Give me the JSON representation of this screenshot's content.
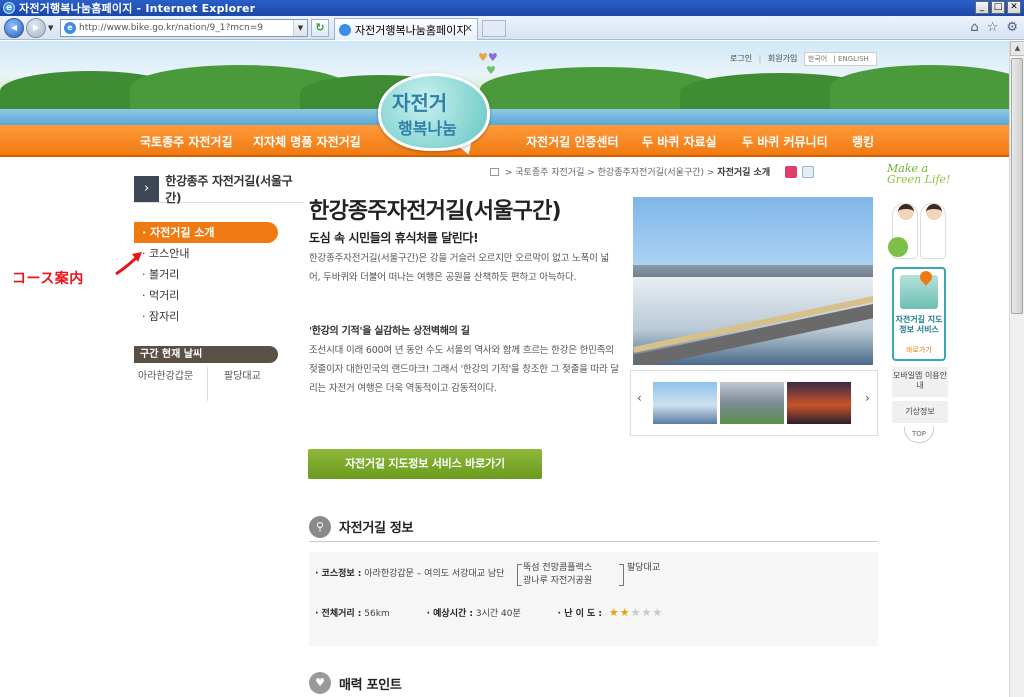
{
  "window": {
    "title": "자전거행복나눔홈페이지 - Internet Explorer",
    "minimize": "_",
    "maximize": "□",
    "close": "✕"
  },
  "browser": {
    "address": "http://www.bike.go.kr/nation/9_1?mcn=9",
    "tab_label": "자전거행복나눔홈페이지",
    "tab_close": "✕"
  },
  "header": {
    "logo_line1": "자전거",
    "logo_line2": "행복나눔",
    "top_links": [
      "로그인",
      "회원가입"
    ],
    "lang": [
      "한국어",
      "ENGLISH"
    ],
    "gnb": [
      "국토종주 자전거길",
      "지자체 명품 자전거길",
      "자전거길 인증센터",
      "두 바퀴 자료실",
      "두 바퀴 커뮤니티",
      "랭킹"
    ]
  },
  "lnb": {
    "title": "한강종주 자전거길(서울구간)",
    "items": [
      "· 자전거길 소개",
      "· 코스안내",
      "· 볼거리",
      "· 먹거리",
      "· 잠자리"
    ],
    "weather_title": "구간 현재 날씨",
    "weather_points": [
      "아라한강갑문",
      "팔당대교"
    ]
  },
  "annotation": {
    "text": "コース案内"
  },
  "breadcrumb": {
    "items": [
      "국토종주 자전거길",
      "한강종주자전거길(서울구간)"
    ],
    "current": "자전거길 소개"
  },
  "content": {
    "title": "한강종주자전거길(서울구간)",
    "subtitle": "도심 속 시민들의 휴식처를 달린다!",
    "para1": "한강종주자전거길(서울구간)은 강을 거슬러 오르지만 오르막이 없고 노폭이 넓어, 두바퀴와 더불어 떠나는 여행은 공원을 산책하듯 편하고 아늑하다.",
    "heading2": "'한강의 기적'을 실감하는 상전벽해의 길",
    "para2": "조선시대 이래 600여 년 동안 수도 서울의 역사와 함께 흐르는 한강은 한민족의 젖줄이자 대한민국의 랜드마크! 그래서 '한강의 기적'을 창조한 그 젖줄을 따라 달리는 자전거 여행은 더욱 역동적이고 감동적이다.",
    "map_button": "자전거길 지도정보 서비스 바로가기",
    "slider_prev": "‹",
    "slider_next": "›"
  },
  "info": {
    "section_title": "자전거길 정보",
    "course_label": "· 코스정보 :",
    "course_start": "아라한강갑문 – 여의도 서강대교 남단",
    "branch_top": "뚝섬 전망콤플렉스",
    "branch_bottom": "광나루 자전거공원",
    "course_end": "팔당대교",
    "distance_label": "· 전체거리 :",
    "distance": "56km",
    "time_label": "· 예상시간 :",
    "time": "3시간 40분",
    "difficulty_label": "· 난 이 도 :",
    "difficulty_stars": 2,
    "difficulty_max": 5
  },
  "attractions": {
    "section_title": "매력 포인트"
  },
  "quick": {
    "slogan_line1": "Make a",
    "slogan_line2": "Green Life!",
    "map_service_title": "자전거길 지도정보 서비스",
    "map_service_link": "바로가기",
    "mobile_app": "모바일앱 이용안내",
    "weather": "기상정보",
    "top": "TOP"
  },
  "colors": {
    "accent_orange": "#f07a12",
    "button_green": "#7aa82a",
    "teal": "#3ba6b5"
  }
}
